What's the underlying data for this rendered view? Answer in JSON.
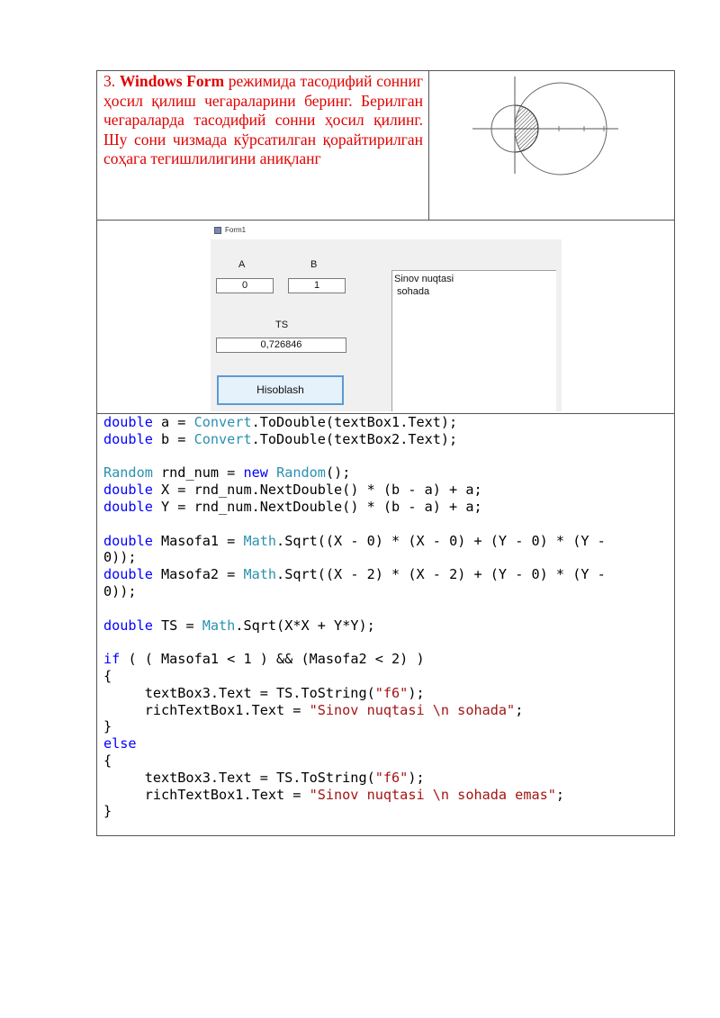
{
  "task": {
    "number": "3.",
    "bold_term": "Windows Form",
    "text": "режимида тасодифий сонниг ҳосил қилиш чегараларини беринг. Берилган чегараларда тасодифий сонни ҳосил қилинг. Шу сони чизмада кўрсатилган қорайтирилган соҳага тегишлилигини аниқланг"
  },
  "form": {
    "title": "Form1",
    "label_a": "A",
    "label_b": "B",
    "value_a": "0",
    "value_b": "1",
    "label_ts": "TS",
    "value_ts": "0,726846",
    "button_label": "Hisoblash",
    "rich_line1": "Sinov nuqtasi",
    "rich_line2": "sohada"
  },
  "colors": {
    "task_text": "#e00000",
    "keyword": "#0000ff",
    "type": "#2b91af",
    "string": "#a31515"
  },
  "code_lines": [
    [
      {
        "t": "double",
        "c": "kw"
      },
      {
        "t": " a = "
      },
      {
        "t": "Convert",
        "c": "ty"
      },
      {
        "t": ".ToDouble(textBox1.Text);"
      }
    ],
    [
      {
        "t": "double",
        "c": "kw"
      },
      {
        "t": " b = "
      },
      {
        "t": "Convert",
        "c": "ty"
      },
      {
        "t": ".ToDouble(textBox2.Text);"
      }
    ],
    [],
    [
      {
        "t": "Random",
        "c": "ty"
      },
      {
        "t": " rnd_num = "
      },
      {
        "t": "new",
        "c": "kw"
      },
      {
        "t": " "
      },
      {
        "t": "Random",
        "c": "ty"
      },
      {
        "t": "();"
      }
    ],
    [
      {
        "t": "double",
        "c": "kw"
      },
      {
        "t": " X = rnd_num.NextDouble() * (b - a) + a;"
      }
    ],
    [
      {
        "t": "double",
        "c": "kw"
      },
      {
        "t": " Y = rnd_num.NextDouble() * (b - a) + a;"
      }
    ],
    [],
    [
      {
        "t": "double",
        "c": "kw"
      },
      {
        "t": " Masofa1 = "
      },
      {
        "t": "Math",
        "c": "ty"
      },
      {
        "t": ".Sqrt((X - 0) * (X - 0) + (Y - 0) * (Y -"
      }
    ],
    [
      {
        "t": "0));"
      }
    ],
    [
      {
        "t": "double",
        "c": "kw"
      },
      {
        "t": " Masofa2 = "
      },
      {
        "t": "Math",
        "c": "ty"
      },
      {
        "t": ".Sqrt((X - 2) * (X - 2) + (Y - 0) * (Y -"
      }
    ],
    [
      {
        "t": "0));"
      }
    ],
    [],
    [
      {
        "t": "double",
        "c": "kw"
      },
      {
        "t": " TS = "
      },
      {
        "t": "Math",
        "c": "ty"
      },
      {
        "t": ".Sqrt(X*X + Y*Y);"
      }
    ],
    [],
    [
      {
        "t": "if",
        "c": "kw"
      },
      {
        "t": " ( ( Masofa1 < 1 ) && (Masofa2 < 2) )"
      }
    ],
    [
      {
        "t": "{"
      }
    ],
    [
      {
        "t": "     textBox3.Text = TS.ToString("
      },
      {
        "t": "\"f6\"",
        "c": "st"
      },
      {
        "t": ");"
      }
    ],
    [
      {
        "t": "     richTextBox1.Text = "
      },
      {
        "t": "\"Sinov nuqtasi \\n sohada\"",
        "c": "st"
      },
      {
        "t": ";"
      }
    ],
    [
      {
        "t": "}"
      }
    ],
    [
      {
        "t": "else",
        "c": "kw"
      }
    ],
    [
      {
        "t": "{"
      }
    ],
    [
      {
        "t": "     textBox3.Text = TS.ToString("
      },
      {
        "t": "\"f6\"",
        "c": "st"
      },
      {
        "t": ");"
      }
    ],
    [
      {
        "t": "     richTextBox1.Text = "
      },
      {
        "t": "\"Sinov nuqtasi \\n sohada emas\"",
        "c": "st"
      },
      {
        "t": ";"
      }
    ],
    [
      {
        "t": "}"
      }
    ]
  ]
}
